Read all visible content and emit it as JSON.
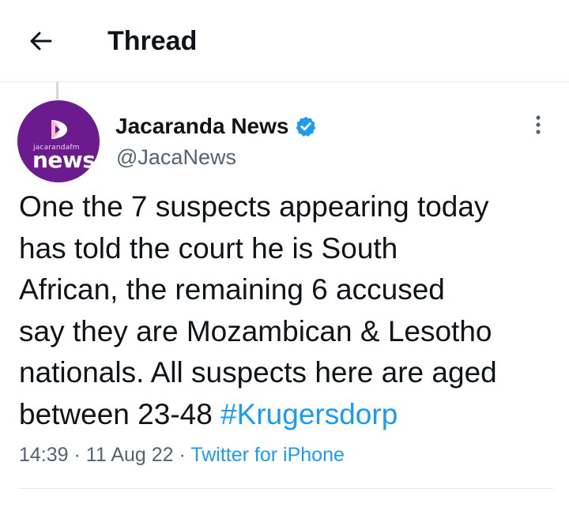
{
  "header": {
    "title": "Thread",
    "back_icon": "arrow-left-icon"
  },
  "tweet": {
    "author": {
      "display_name": "Jacaranda News",
      "handle": "@JacaNews",
      "verified": true,
      "avatar_small_text": "jacarandafm",
      "avatar_text": "news",
      "avatar_color": "#6c1b8f"
    },
    "text_lines": [
      "One the 7 suspects appearing today",
      "has told the court he is South",
      "African, the remaining 6 accused",
      "say they are Mozambican & Lesotho",
      "nationals. All suspects here are aged",
      "between 23-48 "
    ],
    "hashtag": "#Krugersdorp",
    "time": "14:39",
    "date": "11 Aug 22",
    "separator": "·",
    "source": "Twitter for iPhone"
  },
  "colors": {
    "accent": "#1d9bf0",
    "secondary_text": "#536471",
    "primary_text": "#0f1419",
    "divider": "#e6e9eb"
  }
}
